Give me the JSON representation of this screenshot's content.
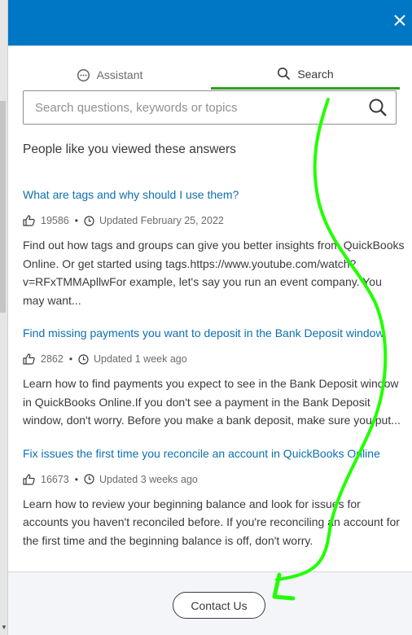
{
  "header": {
    "close_label": "✕"
  },
  "tabs": [
    {
      "label": "Assistant",
      "icon": "chat-bubble-icon",
      "active": false
    },
    {
      "label": "Search",
      "icon": "search-icon",
      "active": true
    }
  ],
  "search": {
    "placeholder": "Search questions, keywords or topics",
    "value": ""
  },
  "section_title": "People like you viewed these answers",
  "articles": [
    {
      "title": "What are tags and why should I use them?",
      "likes": "19586",
      "updated": "Updated February 25, 2022",
      "snippet": "Find out how tags and groups can give you better insights from QuickBooks Online. Or get started using tags.https://www.youtube.com/watch?v=RFxTMMApllwFor example, let's say you run an event company. You may want..."
    },
    {
      "title": "Find missing payments you want to deposit in the Bank Deposit window",
      "likes": "2862",
      "updated": "Updated 1 week ago",
      "snippet": "Learn how to find payments you expect to see in the Bank Deposit window in QuickBooks Online.If you don't see a payment in the Bank Deposit window, don't worry. Before you make a bank deposit, make sure you put..."
    },
    {
      "title": "Fix issues the first time you reconcile an account in QuickBooks Online",
      "likes": "16673",
      "updated": "Updated 3 weeks ago",
      "snippet": "Learn how to review your beginning balance and look for issues for accounts you haven't reconciled before. If you're reconciling an account for the first time and the beginning balance is off, don't worry."
    }
  ],
  "footer": {
    "contact_label": "Contact Us"
  },
  "colors": {
    "header": "#0077c5",
    "link": "#0d6fb0",
    "active_tab": "#2ca01c",
    "annotation": "#22ff00"
  }
}
